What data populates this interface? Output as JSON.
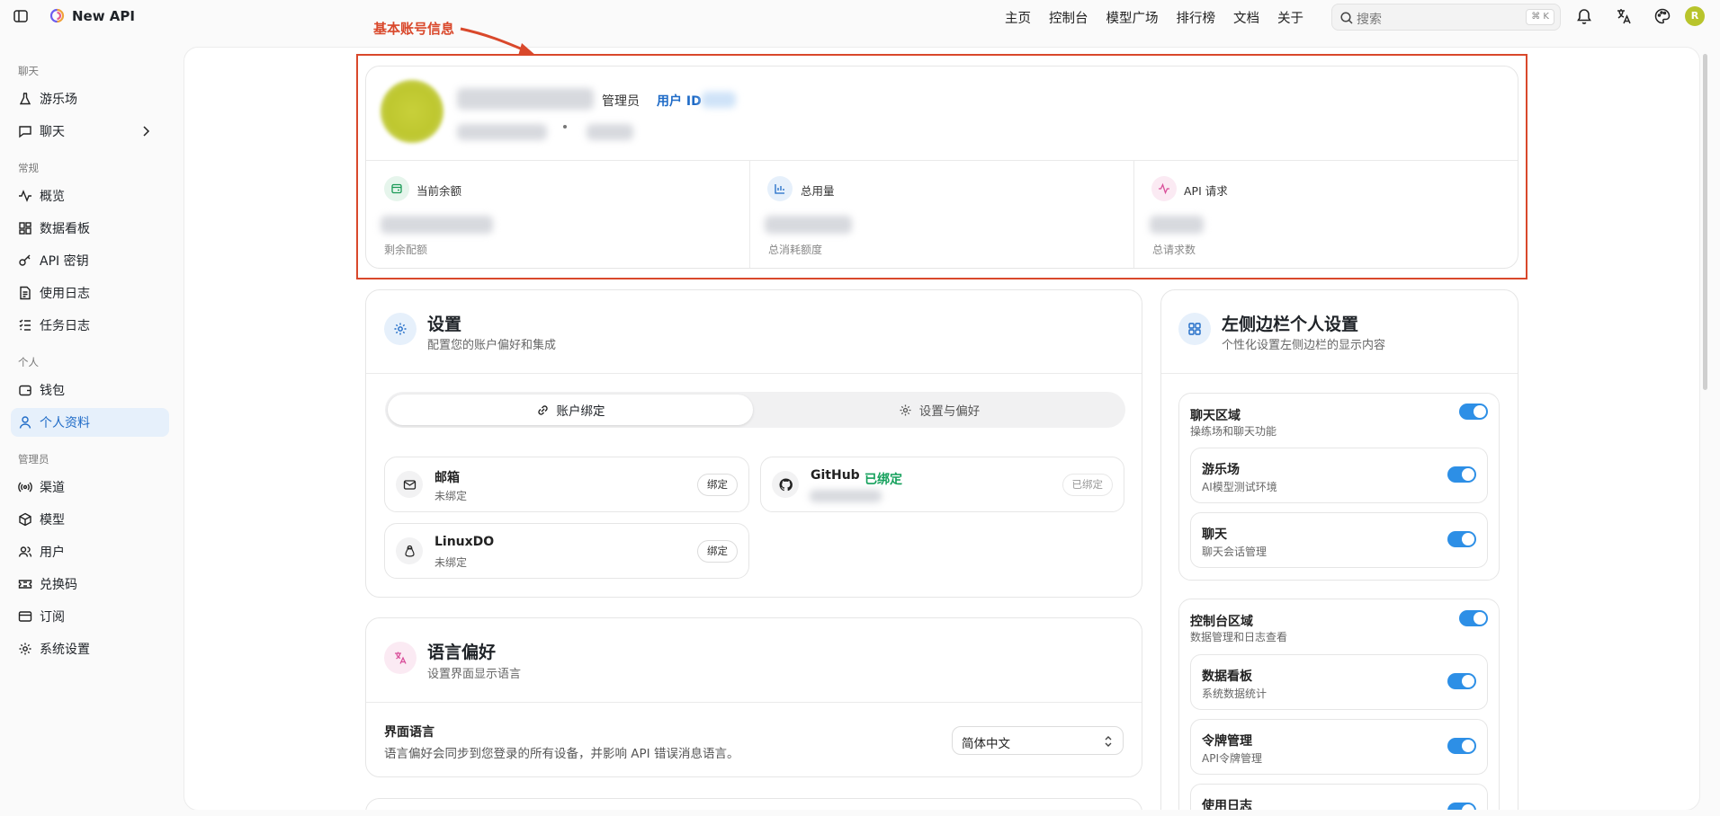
{
  "app": {
    "title": "New API"
  },
  "nav": {
    "items": [
      "主页",
      "控制台",
      "模型广场",
      "排行榜",
      "文档",
      "关于"
    ]
  },
  "search": {
    "placeholder": "搜索",
    "shortcut": "⌘ K"
  },
  "user": {
    "avatar_letter": "R"
  },
  "sidebar": {
    "sections": [
      {
        "title": "聊天",
        "items": [
          {
            "label": "游乐场",
            "icon": "flask-icon"
          },
          {
            "label": "聊天",
            "icon": "message-icon"
          }
        ]
      },
      {
        "title": "常规",
        "items": [
          {
            "label": "概览",
            "icon": "activity-icon"
          },
          {
            "label": "数据看板",
            "icon": "grid-icon"
          },
          {
            "label": "API 密钥",
            "icon": "key-icon"
          },
          {
            "label": "使用日志",
            "icon": "document-icon"
          },
          {
            "label": "任务日志",
            "icon": "list-icon"
          }
        ]
      },
      {
        "title": "个人",
        "items": [
          {
            "label": "钱包",
            "icon": "wallet-icon"
          },
          {
            "label": "个人资料",
            "icon": "user-icon",
            "active": true
          }
        ]
      },
      {
        "title": "管理员",
        "items": [
          {
            "label": "渠道",
            "icon": "broadcast-icon"
          },
          {
            "label": "模型",
            "icon": "cube-icon"
          },
          {
            "label": "用户",
            "icon": "users-icon"
          },
          {
            "label": "兑换码",
            "icon": "ticket-icon"
          },
          {
            "label": "订阅",
            "icon": "card-icon"
          },
          {
            "label": "系统设置",
            "icon": "gear-icon"
          }
        ]
      }
    ]
  },
  "annotation": {
    "label": "基本账号信息",
    "color": "#d9482b"
  },
  "profile": {
    "role": "管理员",
    "user_id_label": "用户 ID",
    "stats": [
      {
        "title": "当前余额",
        "sub": "剩余配额",
        "icon": "wallet-icon"
      },
      {
        "title": "总用量",
        "sub": "总消耗额度",
        "icon": "bar-chart-icon"
      },
      {
        "title": "API 请求",
        "sub": "总请求数",
        "icon": "pulse-icon"
      }
    ]
  },
  "settings": {
    "title": "设置",
    "subtitle": "配置您的账户偏好和集成",
    "tabs": [
      "账户绑定",
      "设置与偏好"
    ],
    "bindings": [
      {
        "name": "邮箱",
        "status": "未绑定",
        "button": "绑定"
      },
      {
        "name": "GitHub",
        "bound_tag": "已绑定",
        "button": "已绑定"
      },
      {
        "name": "LinuxDO",
        "status": "未绑定",
        "button": "绑定"
      }
    ]
  },
  "language": {
    "title": "语言偏好",
    "subtitle": "设置界面显示语言",
    "field_label": "界面语言",
    "field_desc": "语言偏好会同步到您登录的所有设备，并影响 API 错误消息语言。",
    "selected": "简体中文"
  },
  "sidebar_settings": {
    "title": "左侧边栏个人设置",
    "subtitle": "个性化设置左侧边栏的显示内容",
    "groups": [
      {
        "title": "聊天区域",
        "sub": "操练场和聊天功能",
        "enabled": true,
        "items": [
          {
            "title": "游乐场",
            "sub": "AI模型测试环境",
            "enabled": true
          },
          {
            "title": "聊天",
            "sub": "聊天会话管理",
            "enabled": true
          }
        ]
      },
      {
        "title": "控制台区域",
        "sub": "数据管理和日志查看",
        "enabled": true,
        "items": [
          {
            "title": "数据看板",
            "sub": "系统数据统计",
            "enabled": true
          },
          {
            "title": "令牌管理",
            "sub": "API令牌管理",
            "enabled": true
          },
          {
            "title": "使用日志",
            "sub": "",
            "enabled": true
          }
        ]
      }
    ]
  },
  "colors": {
    "accent": "#2d8fe6",
    "success": "#14a05b",
    "link": "#1f6bc7"
  }
}
